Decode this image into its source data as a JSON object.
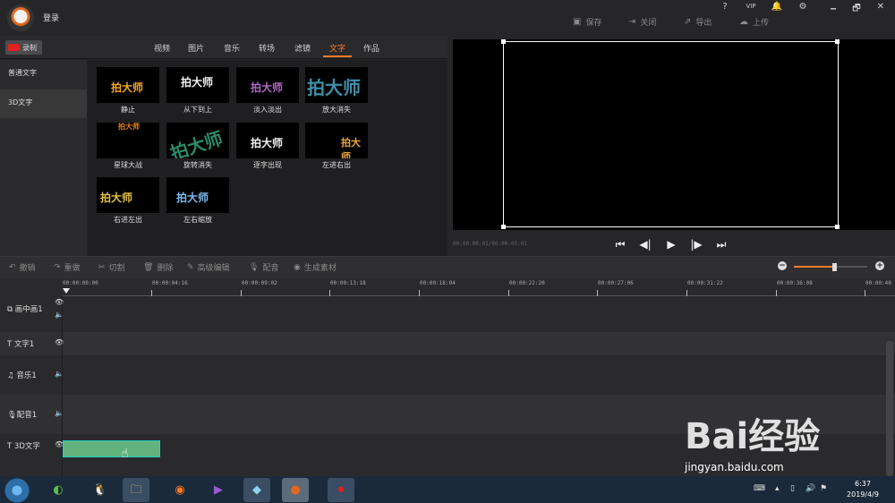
{
  "header": {
    "login": "登录",
    "help": "?",
    "vip": "VIP",
    "bell": "🔔",
    "settings": "⚙",
    "minimize": "🗕",
    "restore": "🗗",
    "close": "✕",
    "save": "保存",
    "close_btn": "关闭",
    "export": "导出",
    "upload": "上传"
  },
  "library": {
    "record": "录制",
    "tabs": [
      "视频",
      "图片",
      "音乐",
      "转场",
      "滤镜",
      "文字",
      "作品"
    ],
    "active_tab": "文字",
    "categories": [
      "普通文字",
      "3D文字"
    ],
    "thumb_text": "拍大师",
    "effects": [
      "静止",
      "从下到上",
      "淡入淡出",
      "放大消失",
      "星球大战",
      "旋转消失",
      "逐字出现",
      "左进右出",
      "右进左出",
      "左右缩放"
    ]
  },
  "player": {
    "timecode": "00:00:00:01/00:00:05:01"
  },
  "editbar": {
    "undo": "撤销",
    "redo": "重做",
    "cut": "切割",
    "delete": "删除",
    "advanced": "高级编辑",
    "dub": "配音",
    "generate": "生成素材"
  },
  "ruler": {
    "ticks": [
      "00:00:00:00",
      "00:00:04:16",
      "00:00:09:02",
      "00:00:13:18",
      "00:00:18:04",
      "00:00:22:20",
      "00:00:27:06",
      "00:00:31:22",
      "00:00:36:08",
      "00:00:40"
    ]
  },
  "tracks": [
    "画中画1",
    "文字1",
    "音乐1",
    "配音1",
    "3D文字"
  ],
  "taskbar": {
    "time": "6:37",
    "date": "2019/4/9"
  },
  "watermark": {
    "brand": "Bai经验",
    "url": "jingyan.baidu.com"
  },
  "colors": {
    "accent": "#ff7a28",
    "clip": "#61b27d"
  }
}
